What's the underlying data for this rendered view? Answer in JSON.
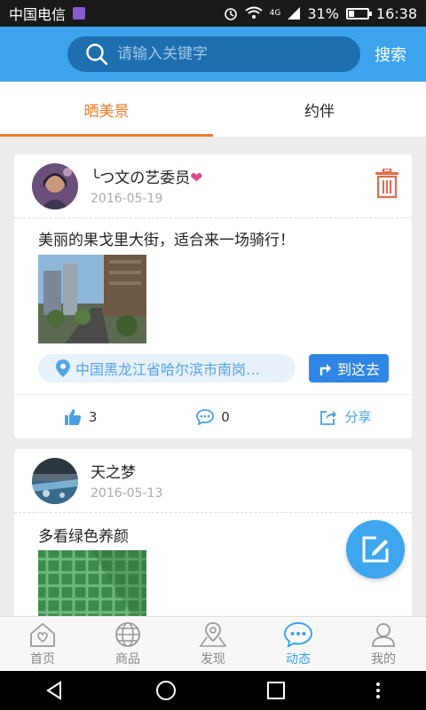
{
  "statusbar": {
    "carrier": "中国电信",
    "network": "4G",
    "battery": "31%",
    "time": "16:38"
  },
  "search": {
    "placeholder": "请输入关键字",
    "button": "搜索"
  },
  "tabs": [
    {
      "label": "晒美景",
      "active": true
    },
    {
      "label": "约伴",
      "active": false
    }
  ],
  "posts": [
    {
      "user": "╰つ文の艺委员",
      "heart": "❤",
      "date": "2016-05-19",
      "text": "美丽的果戈里大街，适合来一场骑行！",
      "location": "中国黑龙江省哈尔滨市南岗…",
      "goto_label": "到这去",
      "likes": "3",
      "comments": "0",
      "share_label": "分享"
    },
    {
      "user": "天之梦",
      "date": "2016-05-13",
      "text": "多看绿色养颜"
    }
  ],
  "bottomnav": [
    {
      "label": "首页",
      "icon": "home-icon"
    },
    {
      "label": "商品",
      "icon": "globe-icon"
    },
    {
      "label": "发现",
      "icon": "location-icon"
    },
    {
      "label": "动态",
      "icon": "chat-icon",
      "active": true
    },
    {
      "label": "我的",
      "icon": "user-icon"
    }
  ],
  "colors": {
    "primary": "#3ca3ec",
    "accent": "#f07a26",
    "danger": "#e46a4e"
  }
}
